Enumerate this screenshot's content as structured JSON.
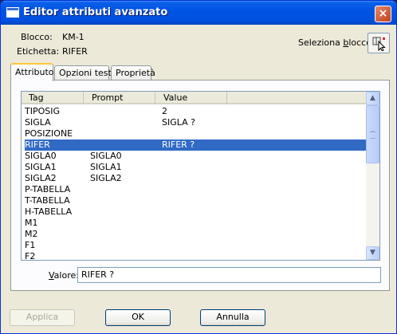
{
  "window": {
    "title": "Editor attributi avanzato",
    "close_glyph": "×"
  },
  "header": {
    "block_label": "Blocco:",
    "block_value": "KM-1",
    "tag_label": "Etichetta:",
    "tag_value": "RIFER",
    "select_block_label": "Seleziona blocco",
    "select_block_icon": "pick-cursor-icon"
  },
  "tabs": [
    {
      "label": "Attributo",
      "active": true
    },
    {
      "label": "Opzioni testo",
      "active": false
    },
    {
      "label": "Proprietà",
      "active": false
    }
  ],
  "list": {
    "columns": [
      "Tag",
      "Prompt",
      "Value"
    ],
    "rows": [
      {
        "tag": "TIPOSIG",
        "prompt": "",
        "value": "2",
        "selected": false
      },
      {
        "tag": "SIGLA",
        "prompt": "",
        "value": "SIGLA ?",
        "selected": false
      },
      {
        "tag": "POSIZIONE",
        "prompt": "",
        "value": "",
        "selected": false
      },
      {
        "tag": "RIFER",
        "prompt": "",
        "value": "RIFER ?",
        "selected": true
      },
      {
        "tag": "SIGLA0",
        "prompt": "SIGLA0",
        "value": "",
        "selected": false
      },
      {
        "tag": "SIGLA1",
        "prompt": "SIGLA1",
        "value": "",
        "selected": false
      },
      {
        "tag": "SIGLA2",
        "prompt": "SIGLA2",
        "value": "",
        "selected": false
      },
      {
        "tag": "P-TABELLA",
        "prompt": "",
        "value": "",
        "selected": false
      },
      {
        "tag": "T-TABELLA",
        "prompt": "",
        "value": "",
        "selected": false
      },
      {
        "tag": "H-TABELLA",
        "prompt": "",
        "value": "",
        "selected": false
      },
      {
        "tag": "M1",
        "prompt": "",
        "value": "",
        "selected": false
      },
      {
        "tag": "M2",
        "prompt": "",
        "value": "",
        "selected": false
      },
      {
        "tag": "F1",
        "prompt": "",
        "value": "",
        "selected": false
      },
      {
        "tag": "F2",
        "prompt": "",
        "value": "",
        "selected": false
      }
    ],
    "scroll_up_glyph": "▲",
    "scroll_down_glyph": "▼"
  },
  "value_field": {
    "label": "Valore:",
    "value": "RIFER ?"
  },
  "buttons": {
    "apply": "Applica",
    "ok": "OK",
    "cancel": "Annulla"
  },
  "colors": {
    "selection": "#316ac5",
    "titlebar": "#0054e3",
    "face": "#ece9d8"
  }
}
